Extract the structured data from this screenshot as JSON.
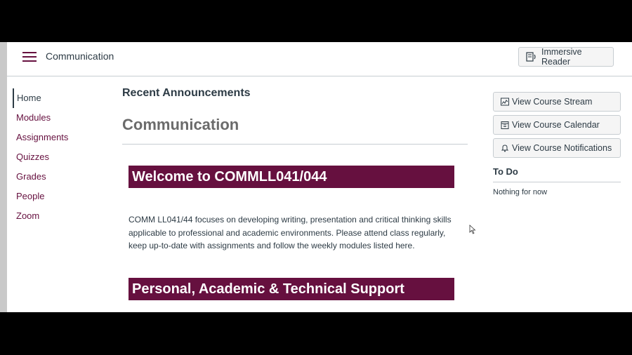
{
  "header": {
    "course_title": "Communication",
    "immersive_reader_label": "Immersive Reader"
  },
  "course_nav": {
    "items": [
      {
        "label": "Home",
        "active": true
      },
      {
        "label": "Modules"
      },
      {
        "label": "Assignments"
      },
      {
        "label": "Quizzes"
      },
      {
        "label": "Grades"
      },
      {
        "label": "People"
      },
      {
        "label": "Zoom"
      }
    ]
  },
  "main": {
    "recent_announcements": "Recent Announcements",
    "page_title": "Communication",
    "welcome_banner": "Welcome to COMMLL041/044",
    "intro_text": "COMM LL041/44 focuses on developing writing, presentation and critical thinking skills applicable to professional and academic environments. Please attend class regularly, keep up-to-date with assignments and follow the weekly modules listed here.",
    "support_banner": "Personal, Academic & Technical Support"
  },
  "sidebar": {
    "buttons": [
      {
        "label": "View Course Stream",
        "icon": "chart-icon"
      },
      {
        "label": "View Course Calendar",
        "icon": "calendar-icon"
      },
      {
        "label": "View Course Notifications",
        "icon": "bell-icon"
      }
    ],
    "todo_heading": "To Do",
    "todo_empty": "Nothing for now"
  },
  "colors": {
    "brand": "#66103f",
    "text": "#2d3b45",
    "title_gray": "#6b6b6b",
    "button_bg": "#f5f5f5",
    "border": "#c7cdd1"
  }
}
